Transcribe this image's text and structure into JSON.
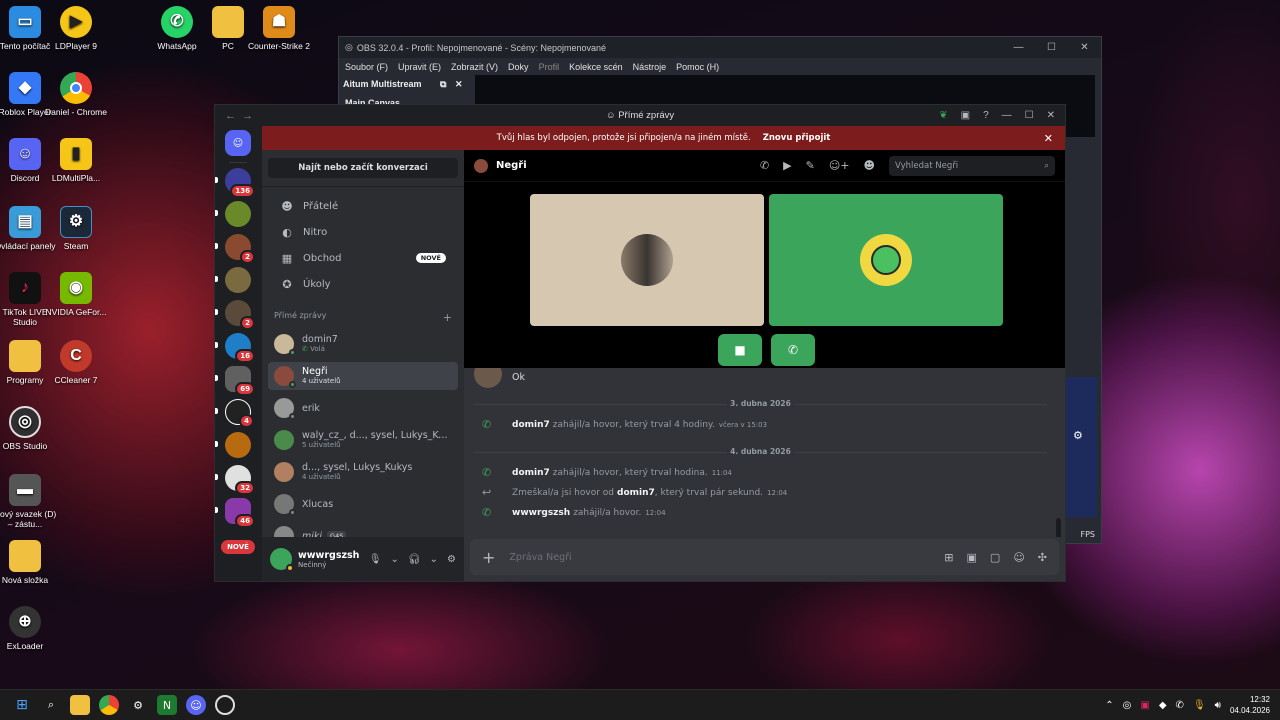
{
  "desktop_icons": [
    {
      "label": "Tento počítač",
      "icon": "computer-icon",
      "color": "#2a8be0"
    },
    {
      "label": "LDPlayer 9",
      "icon": "ldplayer-icon",
      "color": "#f5c518"
    },
    {
      "label": "WhatsApp",
      "icon": "whatsapp-icon",
      "color": "#25d366"
    },
    {
      "label": "PC",
      "icon": "folder-icon",
      "color": "#f0c040"
    },
    {
      "label": "Counter-Strike 2",
      "icon": "cs2-icon",
      "color": "#e08a1a"
    },
    {
      "label": "Roblox Player",
      "icon": "roblox-icon",
      "color": "#3478f6"
    },
    {
      "label": "Daniel - Chrome",
      "icon": "chrome-icon",
      "color": "#ea4335"
    },
    {
      "label": "Discord",
      "icon": "discord-icon",
      "color": "#5865f2"
    },
    {
      "label": "LDMultiPla...",
      "icon": "ldmulti-icon",
      "color": "#f5c518"
    },
    {
      "label": "Ovládací panely",
      "icon": "control-panel-icon",
      "color": "#3a9bd9"
    },
    {
      "label": "Steam",
      "icon": "steam-icon",
      "color": "#1b2838"
    },
    {
      "label": "TikTok LIVE Studio",
      "icon": "tiktok-icon",
      "color": "#111111"
    },
    {
      "label": "NVIDIA GeFor...",
      "icon": "nvidia-icon",
      "color": "#76b900"
    },
    {
      "label": "Programy",
      "icon": "folder-icon",
      "color": "#f0c040"
    },
    {
      "label": "CCleaner 7",
      "icon": "ccleaner-icon",
      "color": "#c0392b"
    },
    {
      "label": "OBS Studio",
      "icon": "obs-icon",
      "color": "#302e31"
    },
    {
      "label": "Nový svazek (D) – zástu...",
      "icon": "drive-icon",
      "color": "#555555"
    },
    {
      "label": "Nová složka",
      "icon": "folder-icon",
      "color": "#f0c040"
    },
    {
      "label": "ExLoader",
      "icon": "exloader-icon",
      "color": "#333333"
    }
  ],
  "obs": {
    "title": "OBS 32.0.4 - Profil: Nepojmenované - Scény: Nepojmenované",
    "menu": [
      "Soubor (F)",
      "Upravit (E)",
      "Zobrazit (V)",
      "Doky",
      "Profil",
      "Kolekce scén",
      "Nástroje",
      "Pomoc (H)"
    ],
    "dock_title": "Aitum Multistream",
    "canvas_title": "Main Canvas",
    "fps": "FPS"
  },
  "discord": {
    "window_title": "Přímé zprávy",
    "banner": {
      "text": "Tvůj hlas byl odpojen, protože jsi připojen/a na jiném místě.",
      "action": "Znovu připojit"
    },
    "servers": [
      {
        "badge": "136",
        "color": "#3b3f9b"
      },
      {
        "badge": "",
        "color": "#6a8a2a"
      },
      {
        "badge": "2",
        "color": "#8a4a30"
      },
      {
        "badge": "",
        "color": "#7a6a40"
      },
      {
        "badge": "2",
        "color": "#5a4a3a"
      },
      {
        "badge": "16",
        "color": "#1e7fc8"
      },
      {
        "badge": "69",
        "color": "#606060"
      },
      {
        "badge": "4",
        "color": "#222222"
      },
      {
        "badge": "",
        "color": "#b86a10"
      },
      {
        "badge": "32",
        "color": "#e0e0e0"
      },
      {
        "badge": "46",
        "color": "#8a3aa8"
      }
    ],
    "new_pill": "NOVÉ",
    "find_button": "Najít nebo začít konverzaci",
    "nav": [
      {
        "label": "Přátelé",
        "icon": "friends-icon"
      },
      {
        "label": "Nitro",
        "icon": "nitro-icon"
      },
      {
        "label": "Obchod",
        "icon": "shop-icon",
        "badge": "NOVÉ"
      },
      {
        "label": "Úkoly",
        "icon": "quests-icon"
      }
    ],
    "dm_header": "Přímé zprávy",
    "dms": [
      {
        "name": "domin7",
        "sub": "Volá",
        "color": "#c9b89a"
      },
      {
        "name": "Negři",
        "sub": "4 uživatelů",
        "color": "#8a4a3c"
      },
      {
        "name": "erik",
        "sub": "",
        "color": "#999999"
      },
      {
        "name": "waly_cz_, d..., sysel, Lukys_Kukys",
        "sub": "5 uživatelů",
        "color": "#4a8a4a"
      },
      {
        "name": "d..., sysel, Lukys_Kukys",
        "sub": "4 uživatelů",
        "color": "#b08060"
      },
      {
        "name": "Xlucas",
        "sub": "",
        "color": "#777777"
      },
      {
        "name": "miki",
        "sub": "",
        "tag": "G4S",
        "color": "#888888"
      }
    ],
    "user": {
      "name": "wwwrgszsh",
      "status": "Nečinný"
    },
    "chat": {
      "name": "Negři",
      "search_placeholder": "Vyhledat Negři",
      "composer_placeholder": "Zpráva Negři",
      "last_message": "Ok",
      "date1": "3. dubna 2026",
      "date2": "4. dubna 2026",
      "events": [
        {
          "user": "domin7",
          "text": "zahájil/a hovor, který trval 4 hodiny.",
          "time": "včera v 15:03",
          "missed": false
        },
        {
          "user": "domin7",
          "text": "zahájil/a hovor, který trval hodina.",
          "time": "11:04",
          "missed": false
        },
        {
          "prefix": "Zmeškal/a jsi hovor od",
          "user": "domin7",
          "text": ", který trval pár sekund.",
          "time": "12:04",
          "missed": true
        },
        {
          "user": "wwwrgszsh",
          "text": "zahájil/a hovor.",
          "time": "12:04",
          "missed": false
        }
      ]
    }
  },
  "taskbar": {
    "time": "12:32",
    "date": "04.04.2026"
  }
}
